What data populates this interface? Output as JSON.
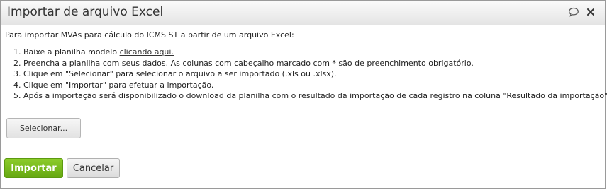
{
  "dialog": {
    "title": "Importar de arquivo Excel"
  },
  "header_icons": [
    "comment-icon",
    "close-icon"
  ],
  "intro_text": "Para importar MVAs para cálculo do ICMS ST a partir de um arquivo Excel:",
  "steps": [
    {
      "prefix": "Baixe a planilha modelo ",
      "link": "clicando aqui.",
      "suffix": ""
    },
    {
      "prefix": "Preencha a planilha com seus dados. As colunas com cabeçalho marcado com * são de preenchimento obrigatório.",
      "link": "",
      "suffix": ""
    },
    {
      "prefix": "Clique em \"Selecionar\" para selecionar o arquivo a ser importado (.xls ou .xlsx).",
      "link": "",
      "suffix": ""
    },
    {
      "prefix": "Clique em \"Importar\" para efetuar a importação.",
      "link": "",
      "suffix": ""
    },
    {
      "prefix": "Após a importação será disponibilizado o download da planilha com o resultado da importação de cada registro na coluna \"Resultado da importação\".",
      "link": "",
      "suffix": ""
    }
  ],
  "buttons": {
    "select_label": "Selecionar...",
    "import_label": "Importar",
    "cancel_label": "Cancelar"
  },
  "colors": {
    "import_button": "#73b51a",
    "titlebar": "#ececec"
  }
}
